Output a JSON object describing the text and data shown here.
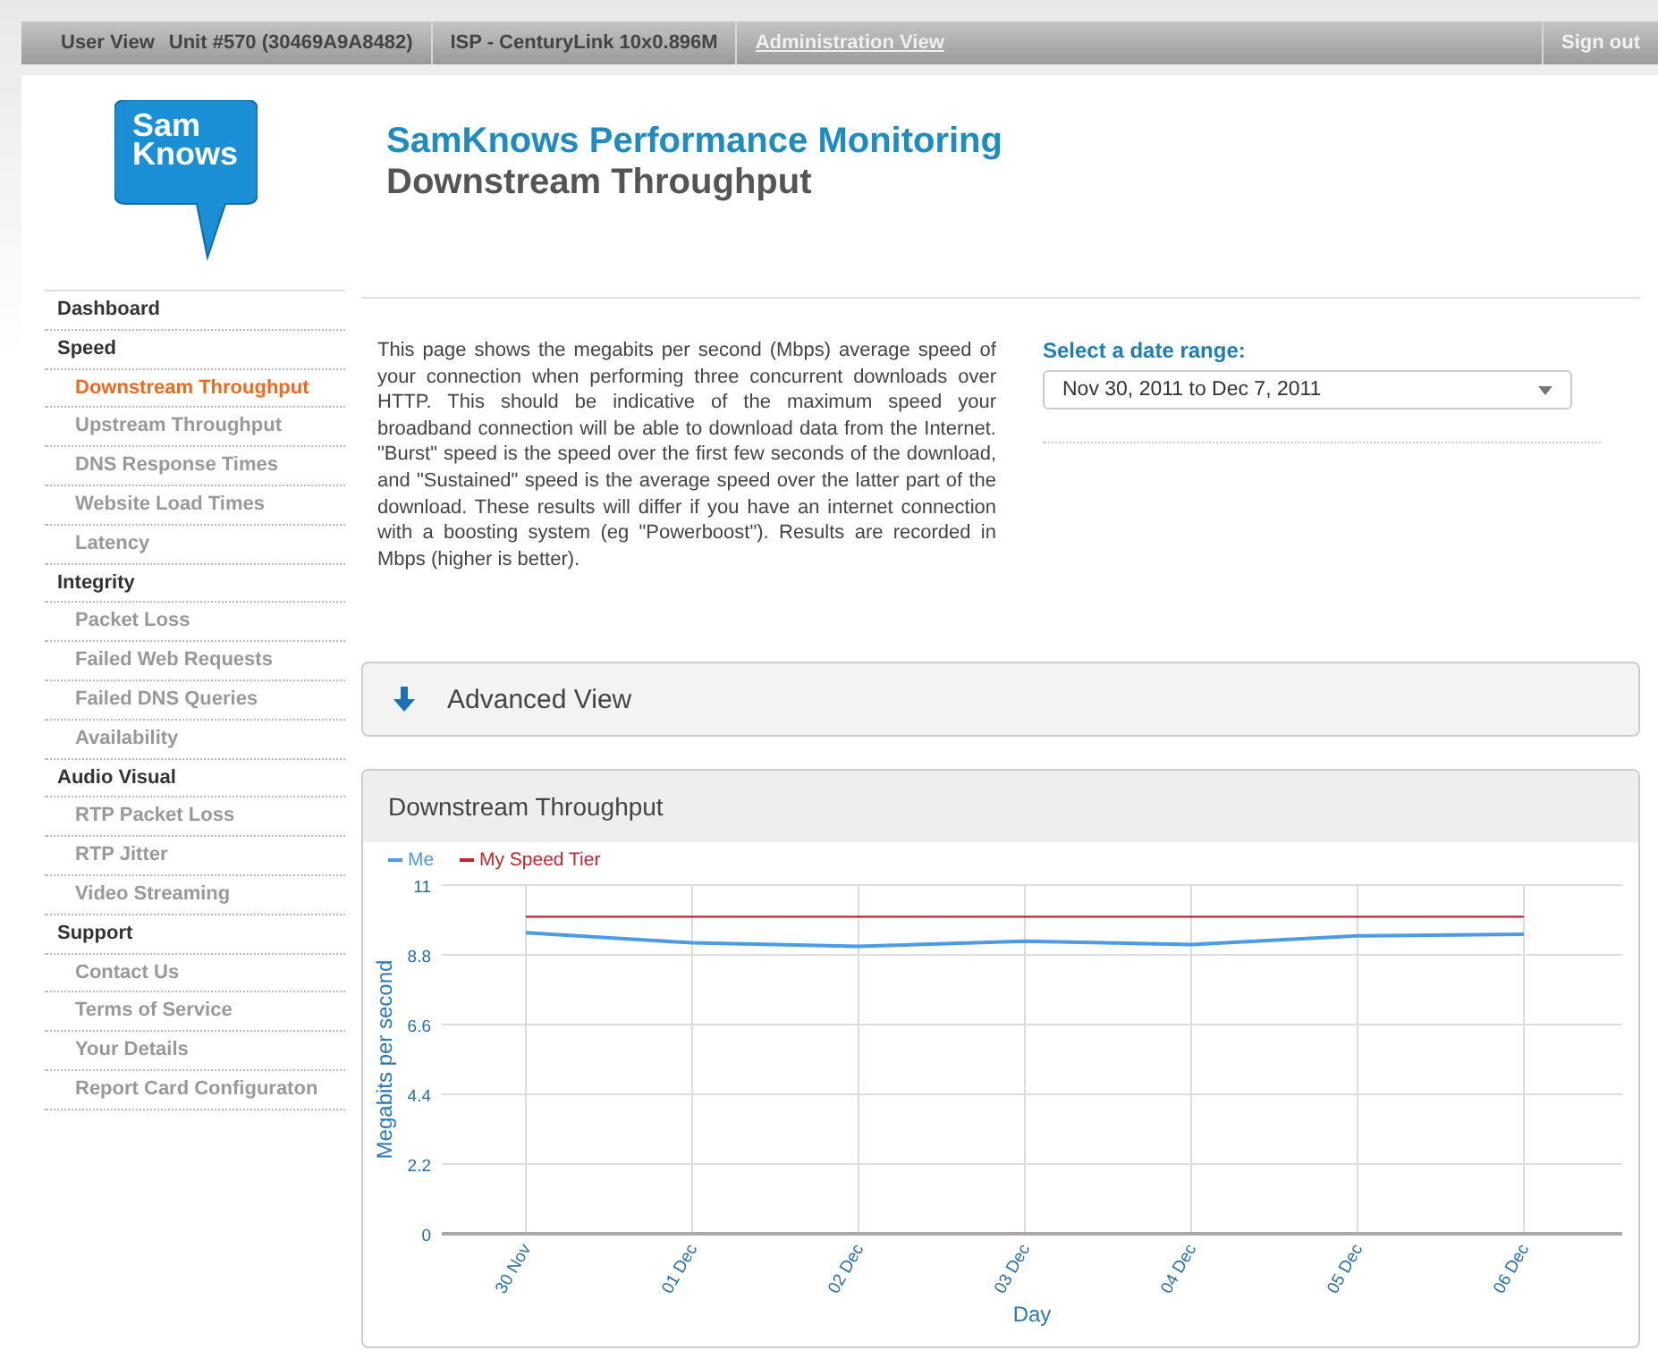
{
  "top_bar": {
    "user_view": "User View",
    "unit": "Unit #570 (30469A9A8482)",
    "isp": "ISP - CenturyLink 10x0.896M",
    "admin_link": "Administration View",
    "sign_out": "Sign out"
  },
  "logo": {
    "line1": "Sam",
    "line2": "Knows"
  },
  "header": {
    "title": "SamKnows Performance Monitoring",
    "subtitle": "Downstream Throughput"
  },
  "sidebar": {
    "items": [
      {
        "label": "Dashboard",
        "kind": "section",
        "selected": false
      },
      {
        "label": "Speed",
        "kind": "section",
        "selected": false
      },
      {
        "label": "Downstream Throughput",
        "kind": "link",
        "selected": true
      },
      {
        "label": "Upstream Throughput",
        "kind": "link",
        "selected": false
      },
      {
        "label": "DNS Response Times",
        "kind": "link",
        "selected": false
      },
      {
        "label": "Website Load Times",
        "kind": "link",
        "selected": false
      },
      {
        "label": "Latency",
        "kind": "link",
        "selected": false
      },
      {
        "label": "Integrity",
        "kind": "section",
        "selected": false
      },
      {
        "label": "Packet Loss",
        "kind": "link",
        "selected": false
      },
      {
        "label": "Failed Web Requests",
        "kind": "link",
        "selected": false
      },
      {
        "label": "Failed DNS Queries",
        "kind": "link",
        "selected": false
      },
      {
        "label": "Availability",
        "kind": "link",
        "selected": false
      },
      {
        "label": "Audio Visual",
        "kind": "section",
        "selected": false
      },
      {
        "label": "RTP Packet Loss",
        "kind": "link",
        "selected": false
      },
      {
        "label": "RTP Jitter",
        "kind": "link",
        "selected": false
      },
      {
        "label": "Video Streaming",
        "kind": "link",
        "selected": false
      },
      {
        "label": "Support",
        "kind": "section",
        "selected": false
      },
      {
        "label": "Contact Us",
        "kind": "link",
        "selected": false
      },
      {
        "label": "Terms of Service",
        "kind": "link",
        "selected": false
      },
      {
        "label": "Your Details",
        "kind": "link",
        "selected": false
      },
      {
        "label": "Report Card Configuraton",
        "kind": "link",
        "selected": false
      }
    ]
  },
  "description": "This page shows the megabits per second (Mbps) average speed of your connection when performing three concurrent downloads over HTTP. This should be indicative of the maximum speed your broadband connection will be able to download data from the Internet. \"Burst\" speed is the speed over the first few seconds of the download, and \"Sustained\" speed is the average speed over the latter part of the download. These results will differ if you have an internet connection with a boosting system (eg \"Powerboost\"). Results are recorded in Mbps (higher is better).",
  "date_range": {
    "label": "Select a date range:",
    "value": "Nov 30, 2011 to Dec 7, 2011"
  },
  "advanced_view": {
    "label": "Advanced View"
  },
  "chart_panel": {
    "title": "Downstream Throughput",
    "chart_data": {
      "type": "line",
      "xlabel": "Day",
      "ylabel": "Megabits per second",
      "categories": [
        "30 Nov",
        "01 Dec",
        "02 Dec",
        "03 Dec",
        "04 Dec",
        "05 Dec",
        "06 Dec"
      ],
      "ylim": [
        0,
        11
      ],
      "yticks": [
        0,
        2.2,
        4.4,
        6.6,
        8.8,
        11
      ],
      "grid": true,
      "legend": true,
      "series": [
        {
          "name": "Me",
          "color": "#4a9be8",
          "values": [
            9.5,
            9.18,
            9.07,
            9.23,
            9.12,
            9.4,
            9.45
          ]
        },
        {
          "name": "My Speed Tier",
          "color": "#c0272d",
          "values": [
            10,
            10,
            10,
            10,
            10,
            10,
            10
          ]
        }
      ]
    }
  }
}
